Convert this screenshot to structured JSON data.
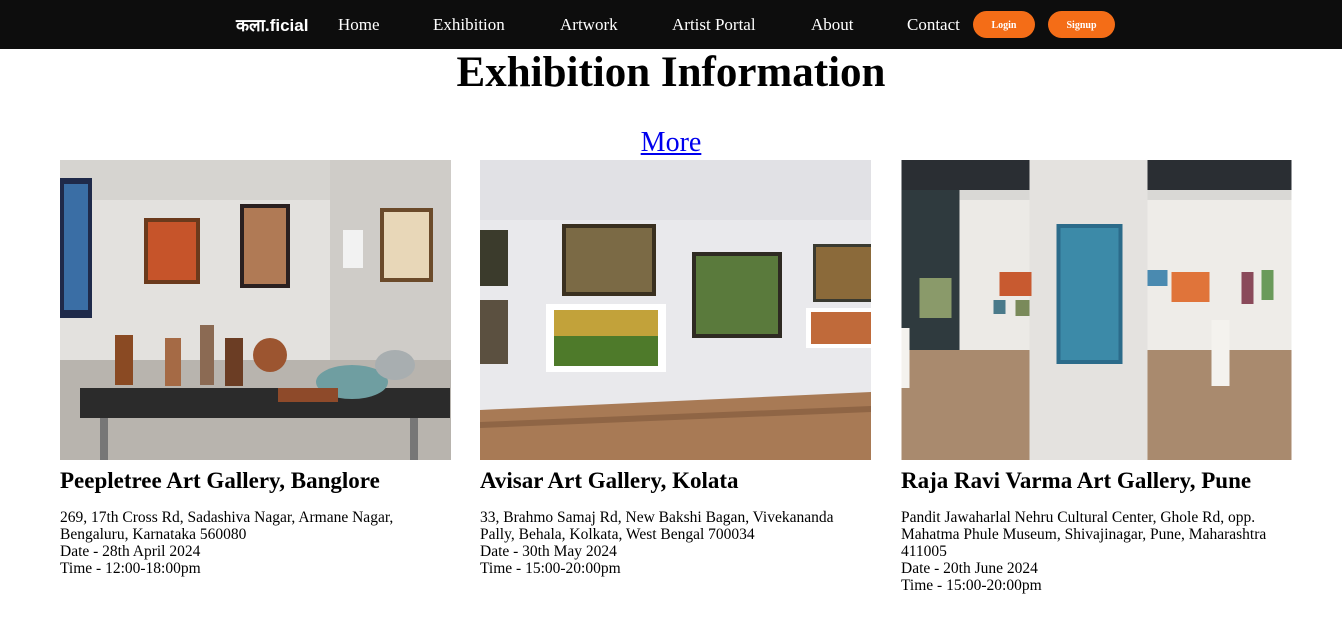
{
  "nav": {
    "logo": "कला.ficial",
    "links": [
      "Home",
      "Exhibition",
      "Artwork",
      "Artist Portal",
      "About",
      "Contact"
    ],
    "login_label": "Login",
    "signup_label": "Signup",
    "accent_color": "#f46d17",
    "background_color": "#0d0d0d"
  },
  "main": {
    "title": "Exhibition Information",
    "more_label": "More"
  },
  "exhibitions": [
    {
      "name": "Peepletree Art Gallery, Banglore",
      "address": "269, 17th Cross Rd, Sadashiva Nagar, Armane Nagar, Bengaluru, Karnataka 560080",
      "date": "Date - 28th April 2024",
      "time": "Time - 12:00-18:00pm"
    },
    {
      "name": "Avisar Art Gallery, Kolata",
      "address": "33, Brahmo Samaj Rd, New Bakshi Bagan, Vivekananda Pally, Behala, Kolkata, West Bengal 700034",
      "date": "Date - 30th May 2024",
      "time": "Time - 15:00-20:00pm"
    },
    {
      "name": "Raja Ravi Varma Art Gallery, Pune",
      "address": "Pandit Jawaharlal Nehru Cultural Center, Ghole Rd, opp. Mahatma Phule Museum, Shivajinagar, Pune, Maharashtra 411005",
      "date": "Date - 20th June 2024",
      "time": "Time - 15:00-20:00pm"
    }
  ]
}
